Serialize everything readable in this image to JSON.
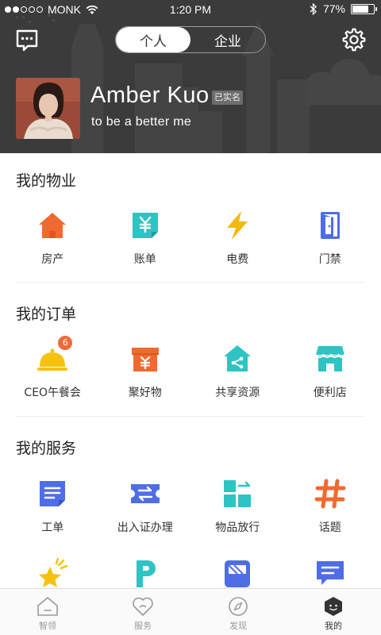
{
  "status_bar": {
    "carrier": "MONK",
    "time": "1:20 PM",
    "battery": "77%",
    "battery_level": 0.77
  },
  "header": {
    "segments": [
      {
        "label": "个人",
        "active": true
      },
      {
        "label": "企业",
        "active": false
      }
    ],
    "profile": {
      "name": "Amber Kuo",
      "verified_label": "已实名",
      "tagline": "to be a better me"
    }
  },
  "sections": [
    {
      "title": "我的物业",
      "items": [
        {
          "label": "房产",
          "icon": "house-icon",
          "color": "#f06a2f"
        },
        {
          "label": "账单",
          "icon": "bill-yen-icon",
          "color": "#2ec4c4"
        },
        {
          "label": "电费",
          "icon": "lightning-icon",
          "color": "#f5b80f"
        },
        {
          "label": "门禁",
          "icon": "door-icon",
          "color": "#4f6de6"
        }
      ]
    },
    {
      "title": "我的订单",
      "items": [
        {
          "label": "CEO午餐会",
          "icon": "dish-cloche-icon",
          "color": "#f5c20f",
          "badge": "6"
        },
        {
          "label": "聚好物",
          "icon": "gift-box-yen-icon",
          "color": "#f06a2f"
        },
        {
          "label": "共享资源",
          "icon": "share-house-icon",
          "color": "#2ec4c4"
        },
        {
          "label": "便利店",
          "icon": "store-icon",
          "color": "#2ec4c4"
        }
      ]
    },
    {
      "title": "我的服务",
      "items": [
        {
          "label": "工单",
          "icon": "work-order-icon",
          "color": "#4f6de6"
        },
        {
          "label": "出入证办理",
          "icon": "pass-ticket-icon",
          "color": "#4f6de6"
        },
        {
          "label": "物品放行",
          "icon": "item-release-icon",
          "color": "#2ec4c4"
        },
        {
          "label": "话题",
          "icon": "hashtag-icon",
          "color": "#f06a2f"
        }
      ],
      "more_items": [
        {
          "icon": "star-icon",
          "color": "#f5c20f"
        },
        {
          "icon": "parking-icon",
          "color": "#2ec4c4"
        },
        {
          "icon": "bus-icon",
          "color": "#4f6de6"
        },
        {
          "icon": "message-icon",
          "color": "#4f6de6"
        }
      ]
    }
  ],
  "tabbar": [
    {
      "label": "智领",
      "icon": "home-icon",
      "active": false
    },
    {
      "label": "服务",
      "icon": "heart-icon",
      "active": false
    },
    {
      "label": "发现",
      "icon": "compass-icon",
      "active": false
    },
    {
      "label": "我的",
      "icon": "profile-face-icon",
      "active": true
    }
  ]
}
